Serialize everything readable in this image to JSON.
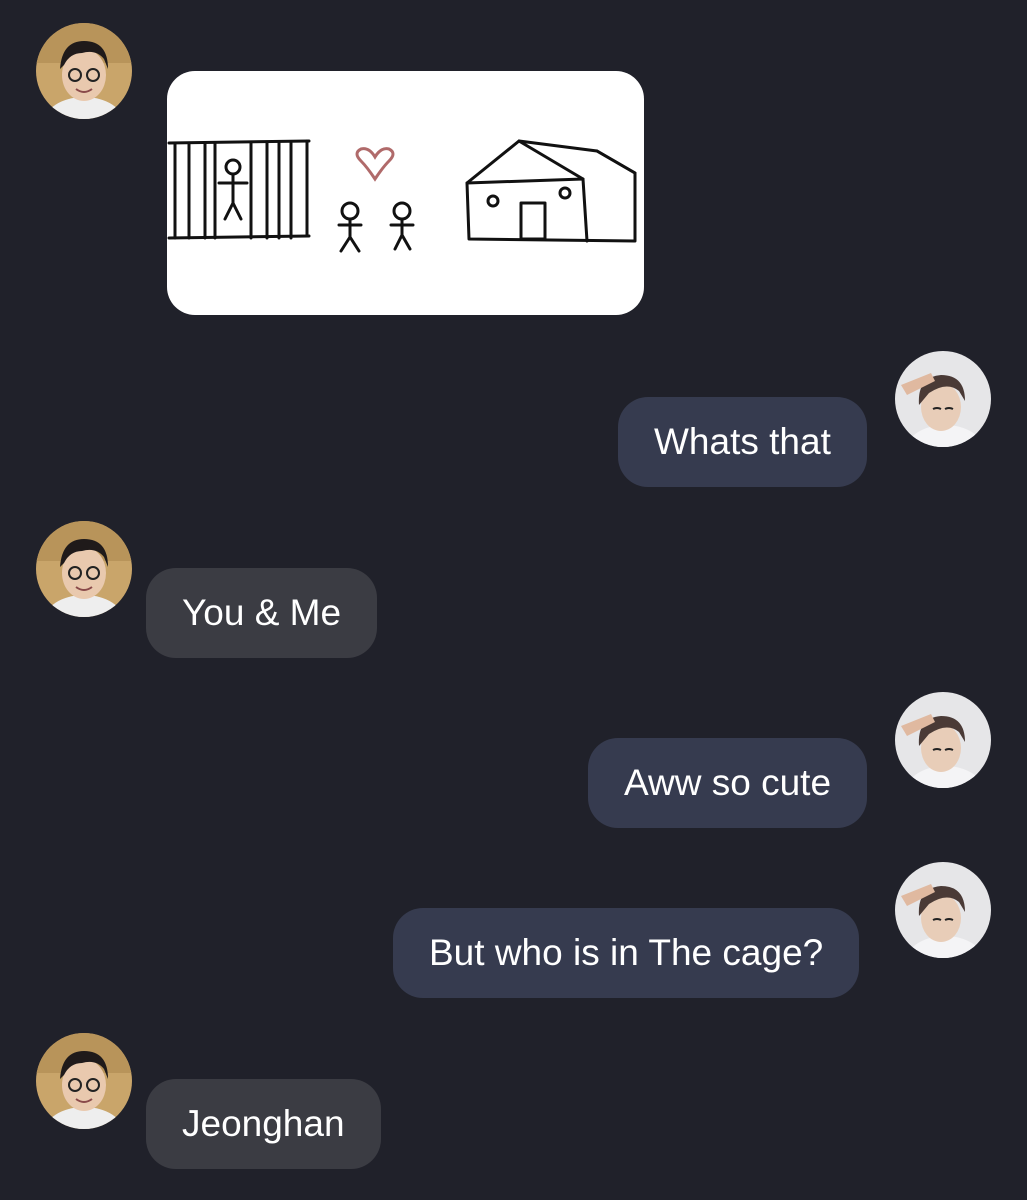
{
  "conversation": {
    "messages": [
      {
        "sender": "other",
        "type": "image",
        "image": "drawing-cage-couple-house"
      },
      {
        "sender": "self",
        "type": "text",
        "text": "Whats that"
      },
      {
        "sender": "other",
        "type": "text",
        "text": "You & Me"
      },
      {
        "sender": "self",
        "type": "text",
        "text": "Aww so cute"
      },
      {
        "sender": "self",
        "type": "text",
        "text": "But who is in The cage?"
      },
      {
        "sender": "other",
        "type": "text",
        "text": "Jeonghan"
      }
    ]
  },
  "colors": {
    "background": "#20212a",
    "incoming_bubble": "#3b3c43",
    "outgoing_bubble": "#363b4f",
    "text": "#ffffff",
    "heart": "#b06a6a"
  },
  "icons": {
    "other_avatar": "avatar-person-glasses",
    "self_avatar": "avatar-person-peace-sign"
  }
}
